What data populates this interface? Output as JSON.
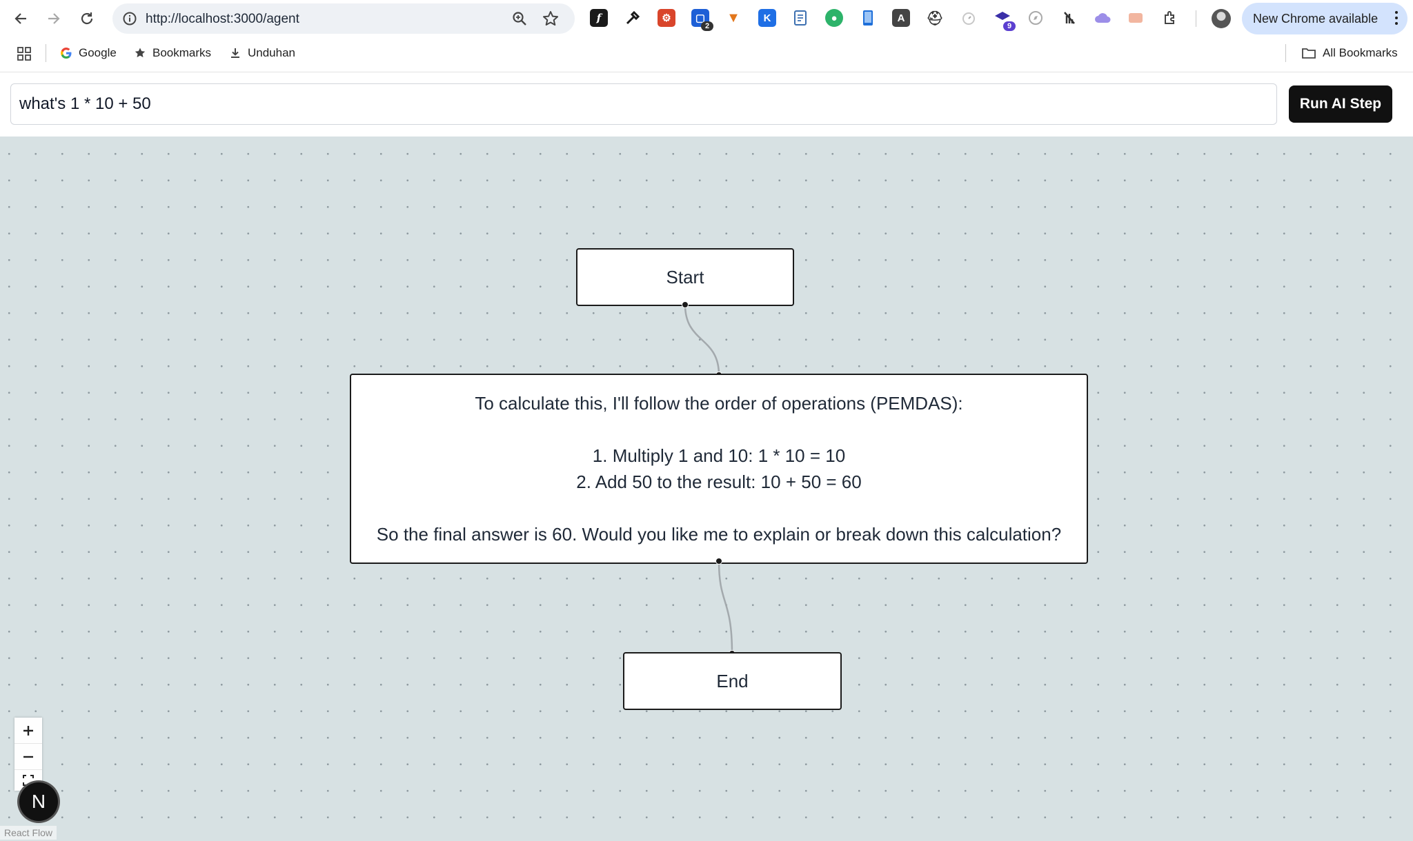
{
  "browser": {
    "url": "http://localhost:3000/agent",
    "update_label": "New Chrome available",
    "extension_badges": {
      "ext4": "2",
      "ext14": "9"
    }
  },
  "bookmarks": {
    "items": [
      {
        "label": "Google",
        "icon": "google-icon"
      },
      {
        "label": "Bookmarks",
        "icon": "star-icon"
      },
      {
        "label": "Unduhan",
        "icon": "download-icon"
      }
    ],
    "all_bookmarks": "All Bookmarks"
  },
  "app": {
    "prompt_value": "what's 1 * 10 + 50",
    "run_button": "Run AI Step"
  },
  "flow": {
    "nodes": {
      "start": "Start",
      "response": "To calculate this, I'll follow the order of operations (PEMDAS):\n\n1. Multiply 1 and 10: 1 * 10 = 10\n2. Add 50 to the result: 10 + 50 = 60\n\nSo the final answer is 60. Would you like me to explain or break down this calculation?",
      "end": "End"
    },
    "controls": [
      "zoom-in-icon",
      "zoom-out-icon",
      "fit-view-icon"
    ],
    "badge_letter": "N",
    "attribution": "React Flow"
  },
  "colors": {
    "canvas_bg": "#d7e1e3",
    "button_bg": "#111111",
    "update_pill": "#d3e3fd"
  }
}
